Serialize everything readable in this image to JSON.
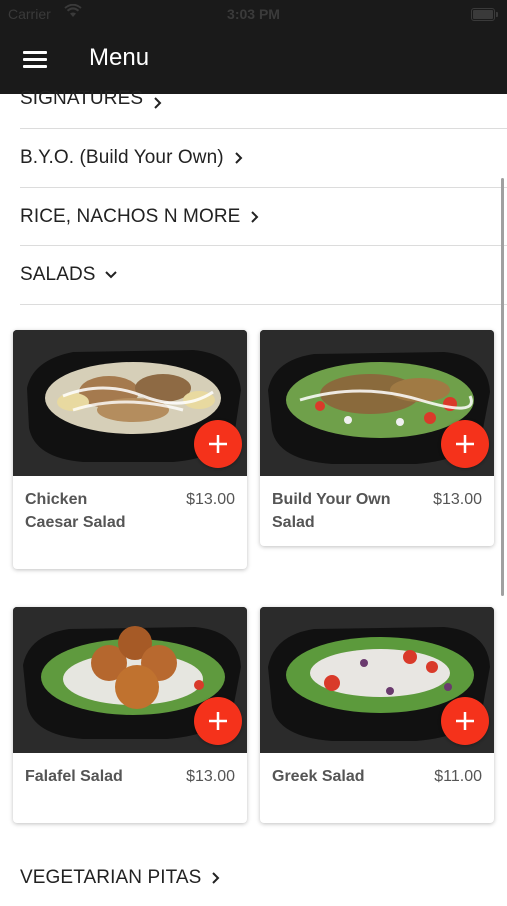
{
  "status_bar": {
    "carrier": "Carrier",
    "time": "3:03 PM"
  },
  "header": {
    "title": "Menu",
    "menu_icon": "hamburger-icon",
    "background": "#1a1a1a"
  },
  "categories": {
    "signatures": "SIGNATURES",
    "byo": "B.Y.O. (Build Your Own)",
    "rice": "RICE, NACHOS N MORE",
    "salads": "SALADS",
    "vegetarian": "VEGETARIAN PITAS"
  },
  "items": [
    {
      "name": "Chicken Caesar Salad",
      "price": "$13.00"
    },
    {
      "name": "Build Your Own Salad",
      "price": "$13.00"
    },
    {
      "name": "Falafel Salad",
      "price": "$13.00"
    },
    {
      "name": "Greek Salad",
      "price": "$11.00"
    }
  ],
  "colors": {
    "accent": "#f5321b",
    "text": "#222222",
    "muted_text": "#555555"
  },
  "icons": {
    "chevron_right": "chevron-right-icon",
    "chevron_down": "chevron-down-icon",
    "plus": "plus-icon"
  }
}
